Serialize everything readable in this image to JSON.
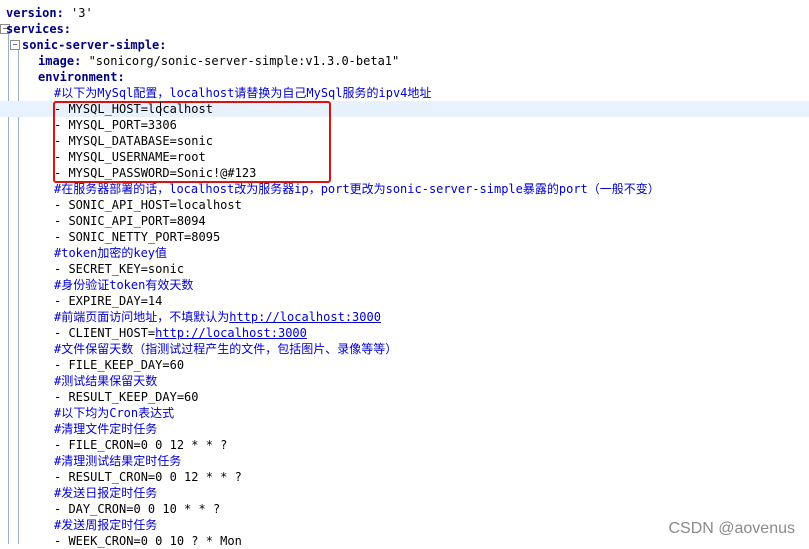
{
  "editor": {
    "lines": [
      {
        "k": "version:",
        "v": " '3'"
      },
      {
        "k": "services:"
      },
      {
        "k": "sonic-server-simple:"
      },
      {
        "k": "image:",
        "v": " \"sonicorg/sonic-server-simple:v1.3.0-beta1\""
      },
      {
        "k": "environment:"
      },
      {
        "c": "#以下为MySql配置，localhost请替换为自己MySql服务的ipv4地址"
      },
      {
        "v": "- MYSQL_HOST=localhost"
      },
      {
        "v": "- MYSQL_PORT=3306"
      },
      {
        "v": "- MYSQL_DATABASE=sonic"
      },
      {
        "v": "- MYSQL_USERNAME=root"
      },
      {
        "v": "- MYSQL_PASSWORD=Sonic!@#123"
      },
      {
        "c": "#在服务器部署的话，localhost改为服务器ip，port更改为sonic-server-simple暴露的port（一般不变）"
      },
      {
        "v": "- SONIC_API_HOST=localhost"
      },
      {
        "v": "- SONIC_API_PORT=8094"
      },
      {
        "v": "- SONIC_NETTY_PORT=8095"
      },
      {
        "c": "#token加密的key值"
      },
      {
        "v": "- SECRET_KEY=sonic"
      },
      {
        "c": "#身份验证token有效天数"
      },
      {
        "v": "- EXPIRE_DAY=14"
      },
      {
        "c": "#前端页面访问地址，不填默认为",
        "u": "http://localhost:3000"
      },
      {
        "v": "- CLIENT_HOST=",
        "u": "http://localhost:3000"
      },
      {
        "c": "#文件保留天数（指测试过程产生的文件，包括图片、录像等等）"
      },
      {
        "v": "- FILE_KEEP_DAY=60"
      },
      {
        "c": "#测试结果保留天数"
      },
      {
        "v": "- RESULT_KEEP_DAY=60"
      },
      {
        "c": "#以下均为Cron表达式"
      },
      {
        "c": "#清理文件定时任务"
      },
      {
        "v": "- FILE_CRON=0 0 12 * * ?"
      },
      {
        "c": "#清理测试结果定时任务"
      },
      {
        "v": "- RESULT_CRON=0 0 12 * * ?"
      },
      {
        "c": "#发送日报定时任务"
      },
      {
        "v": "- DAY_CRON=0 0 10 * * ?"
      },
      {
        "c": "#发送周报定时任务"
      },
      {
        "v": "- WEEK_CRON=0 0 10 ? * Mon"
      }
    ]
  },
  "watermark": "CSDN @aovenus",
  "colors": {
    "highlight_box": "#e01010",
    "comment": "#0000cc",
    "key": "#000080"
  }
}
